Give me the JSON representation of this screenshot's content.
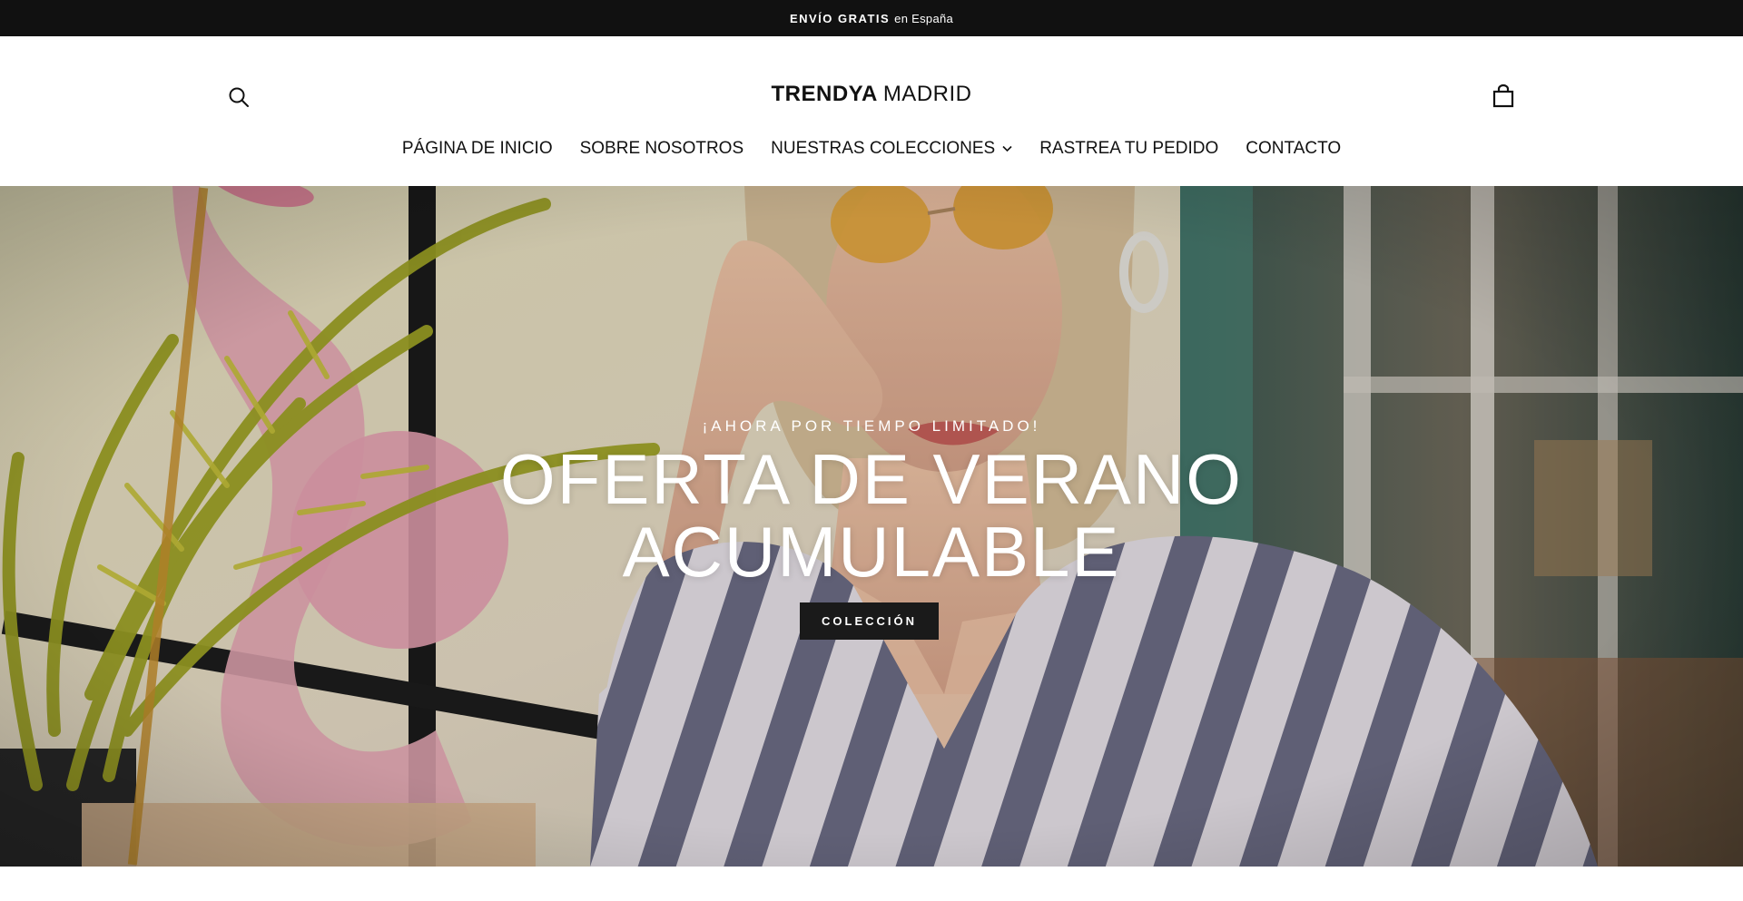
{
  "announcement": {
    "bold_text": "ENVÍO GRATIS",
    "text": "en España"
  },
  "header": {
    "logo": {
      "bold": "TRENDYA",
      "light": "MADRID"
    },
    "icons": {
      "search": "search-icon",
      "cart": "shopping-bag-icon"
    }
  },
  "nav": {
    "items": [
      {
        "label": "PÁGINA DE INICIO"
      },
      {
        "label": "SOBRE NOSOTROS"
      },
      {
        "label": "NUESTRAS COLECCIONES",
        "has_dropdown": true
      },
      {
        "label": "RASTREA TU PEDIDO"
      },
      {
        "label": "CONTACTO"
      }
    ]
  },
  "hero": {
    "subtitle": "¡AHORA POR TIEMPO LIMITADO!",
    "title_line1": "OFERTA DE VERANO",
    "title_line2": "ACUMULABLE",
    "button_label": "COLECCIÓN"
  },
  "colors": {
    "announcement_bg": "#111111",
    "button_bg": "#1a1a1a",
    "text_dark": "#111111"
  }
}
